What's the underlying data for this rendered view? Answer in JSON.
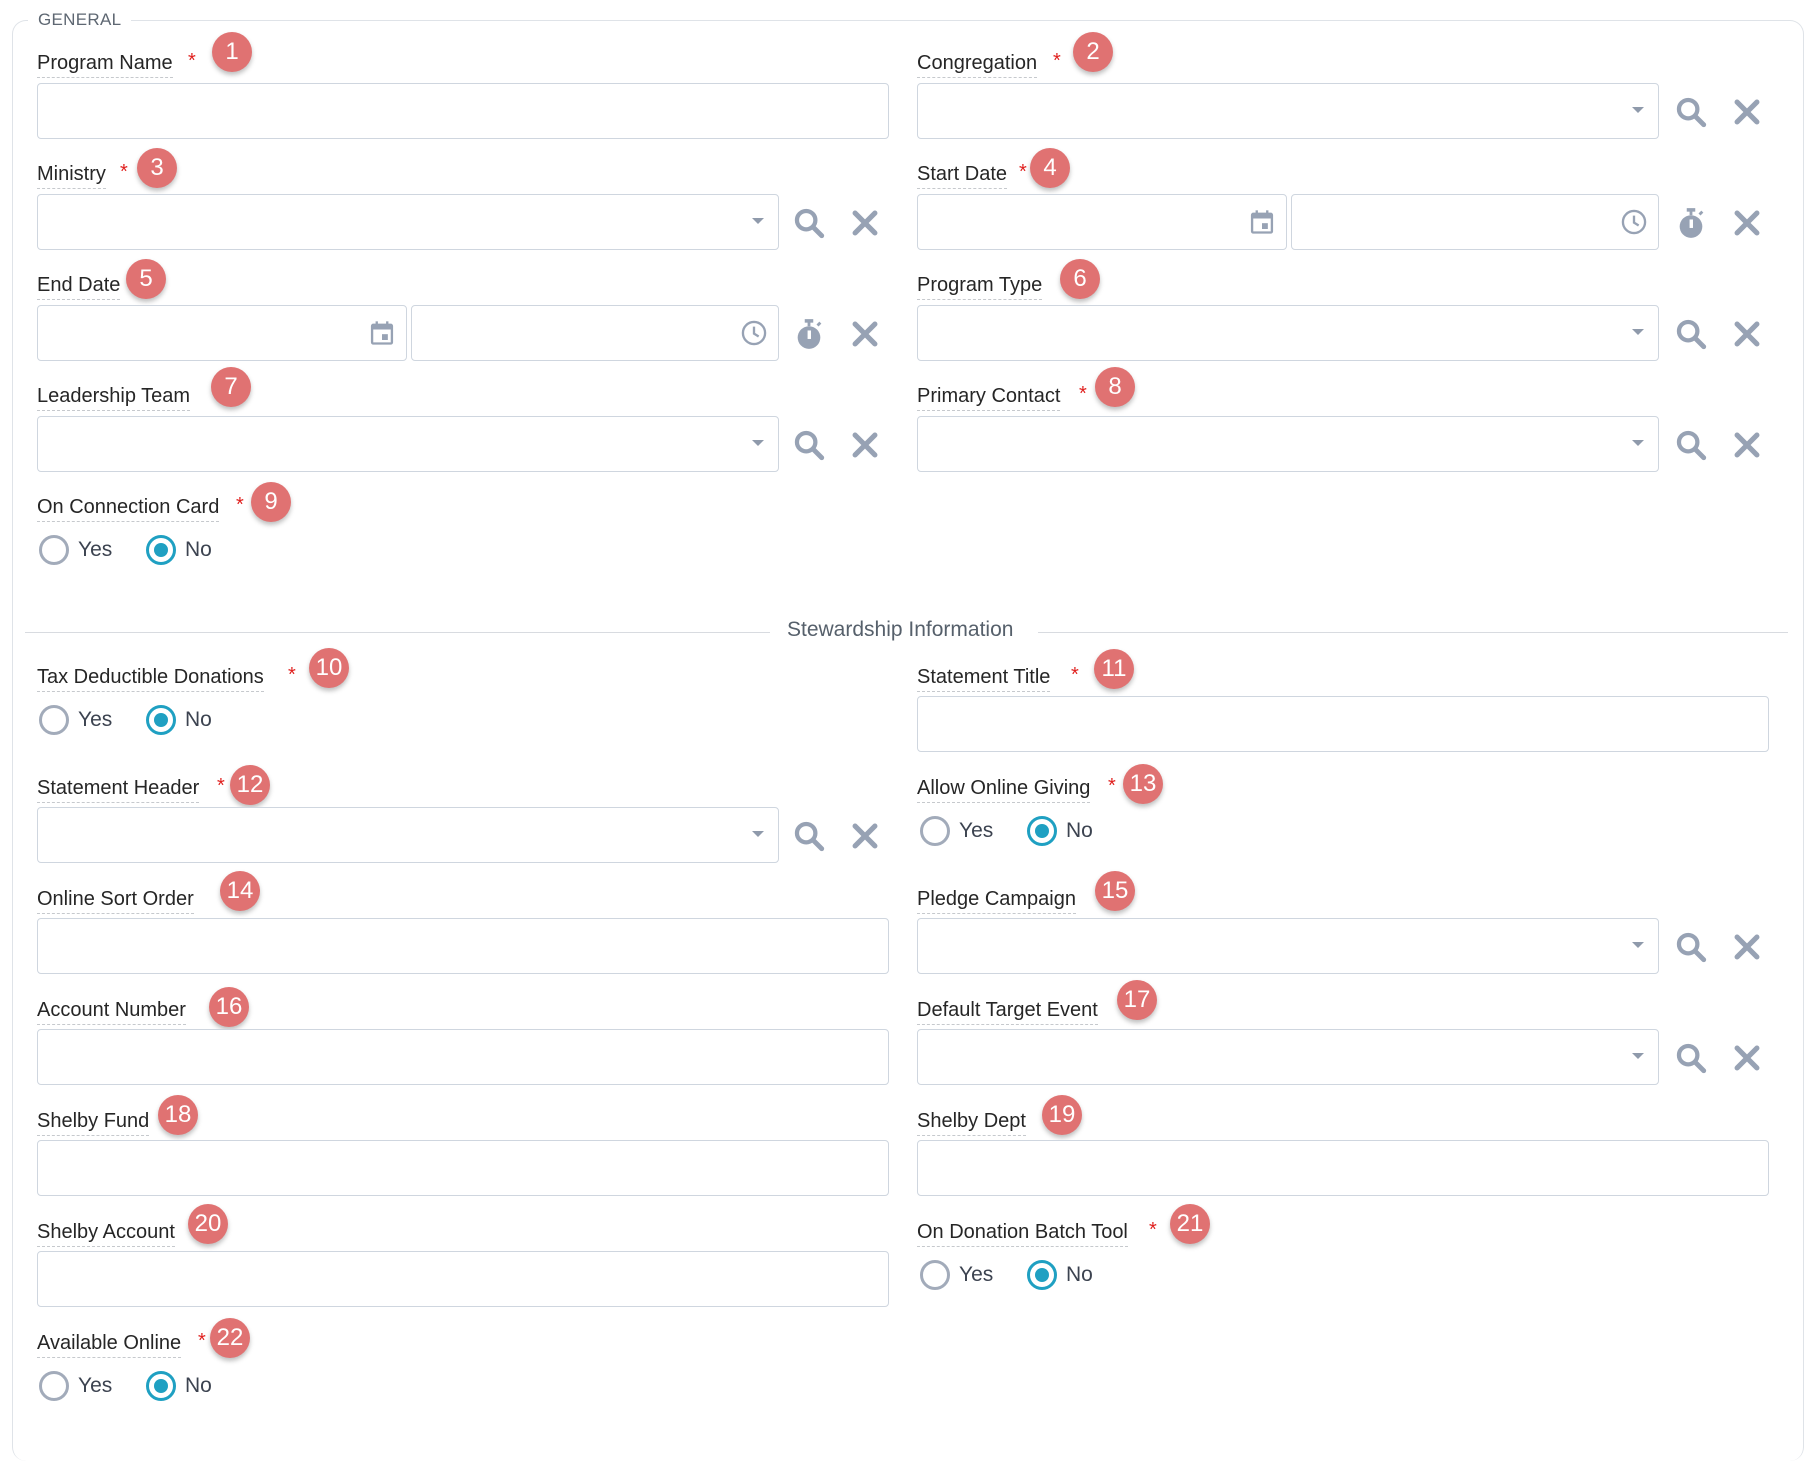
{
  "section_general": "GENERAL",
  "section_stewardship": "Stewardship Information",
  "required_mark": "*",
  "radio_labels": {
    "yes": "Yes",
    "no": "No"
  },
  "fields": {
    "program_name": {
      "label": "Program Name",
      "badge": "1",
      "value": ""
    },
    "congregation": {
      "label": "Congregation",
      "badge": "2",
      "value": ""
    },
    "ministry": {
      "label": "Ministry",
      "badge": "3",
      "value": ""
    },
    "start_date": {
      "label": "Start Date",
      "badge": "4",
      "date": "",
      "time": ""
    },
    "end_date": {
      "label": "End Date",
      "badge": "5",
      "date": "",
      "time": ""
    },
    "program_type": {
      "label": "Program Type",
      "badge": "6",
      "value": ""
    },
    "leadership_team": {
      "label": "Leadership Team",
      "badge": "7",
      "value": ""
    },
    "primary_contact": {
      "label": "Primary Contact",
      "badge": "8",
      "value": ""
    },
    "on_connection_card": {
      "label": "On Connection Card",
      "badge": "9",
      "selected": "No"
    },
    "tax_deductible": {
      "label": "Tax Deductible Donations",
      "badge": "10",
      "selected": "No"
    },
    "statement_title": {
      "label": "Statement Title",
      "badge": "11",
      "value": ""
    },
    "statement_header": {
      "label": "Statement Header",
      "badge": "12",
      "value": ""
    },
    "allow_online_giving": {
      "label": "Allow Online Giving",
      "badge": "13",
      "selected": "No"
    },
    "online_sort_order": {
      "label": "Online Sort Order",
      "badge": "14",
      "value": ""
    },
    "pledge_campaign": {
      "label": "Pledge Campaign",
      "badge": "15",
      "value": ""
    },
    "account_number": {
      "label": "Account Number",
      "badge": "16",
      "value": ""
    },
    "default_target_event": {
      "label": "Default Target Event",
      "badge": "17",
      "value": ""
    },
    "shelby_fund": {
      "label": "Shelby Fund",
      "badge": "18",
      "value": ""
    },
    "shelby_dept": {
      "label": "Shelby Dept",
      "badge": "19",
      "value": ""
    },
    "shelby_account": {
      "label": "Shelby Account",
      "badge": "20",
      "value": ""
    },
    "on_donation_batch_tool": {
      "label": "On Donation Batch Tool",
      "badge": "21",
      "selected": "No"
    },
    "available_online": {
      "label": "Available Online",
      "badge": "22",
      "selected": "No"
    }
  },
  "colors": {
    "accent": "#1fa0c2",
    "badge": "#e07272",
    "required": "#e0201e",
    "icon": "#97a2b4"
  }
}
